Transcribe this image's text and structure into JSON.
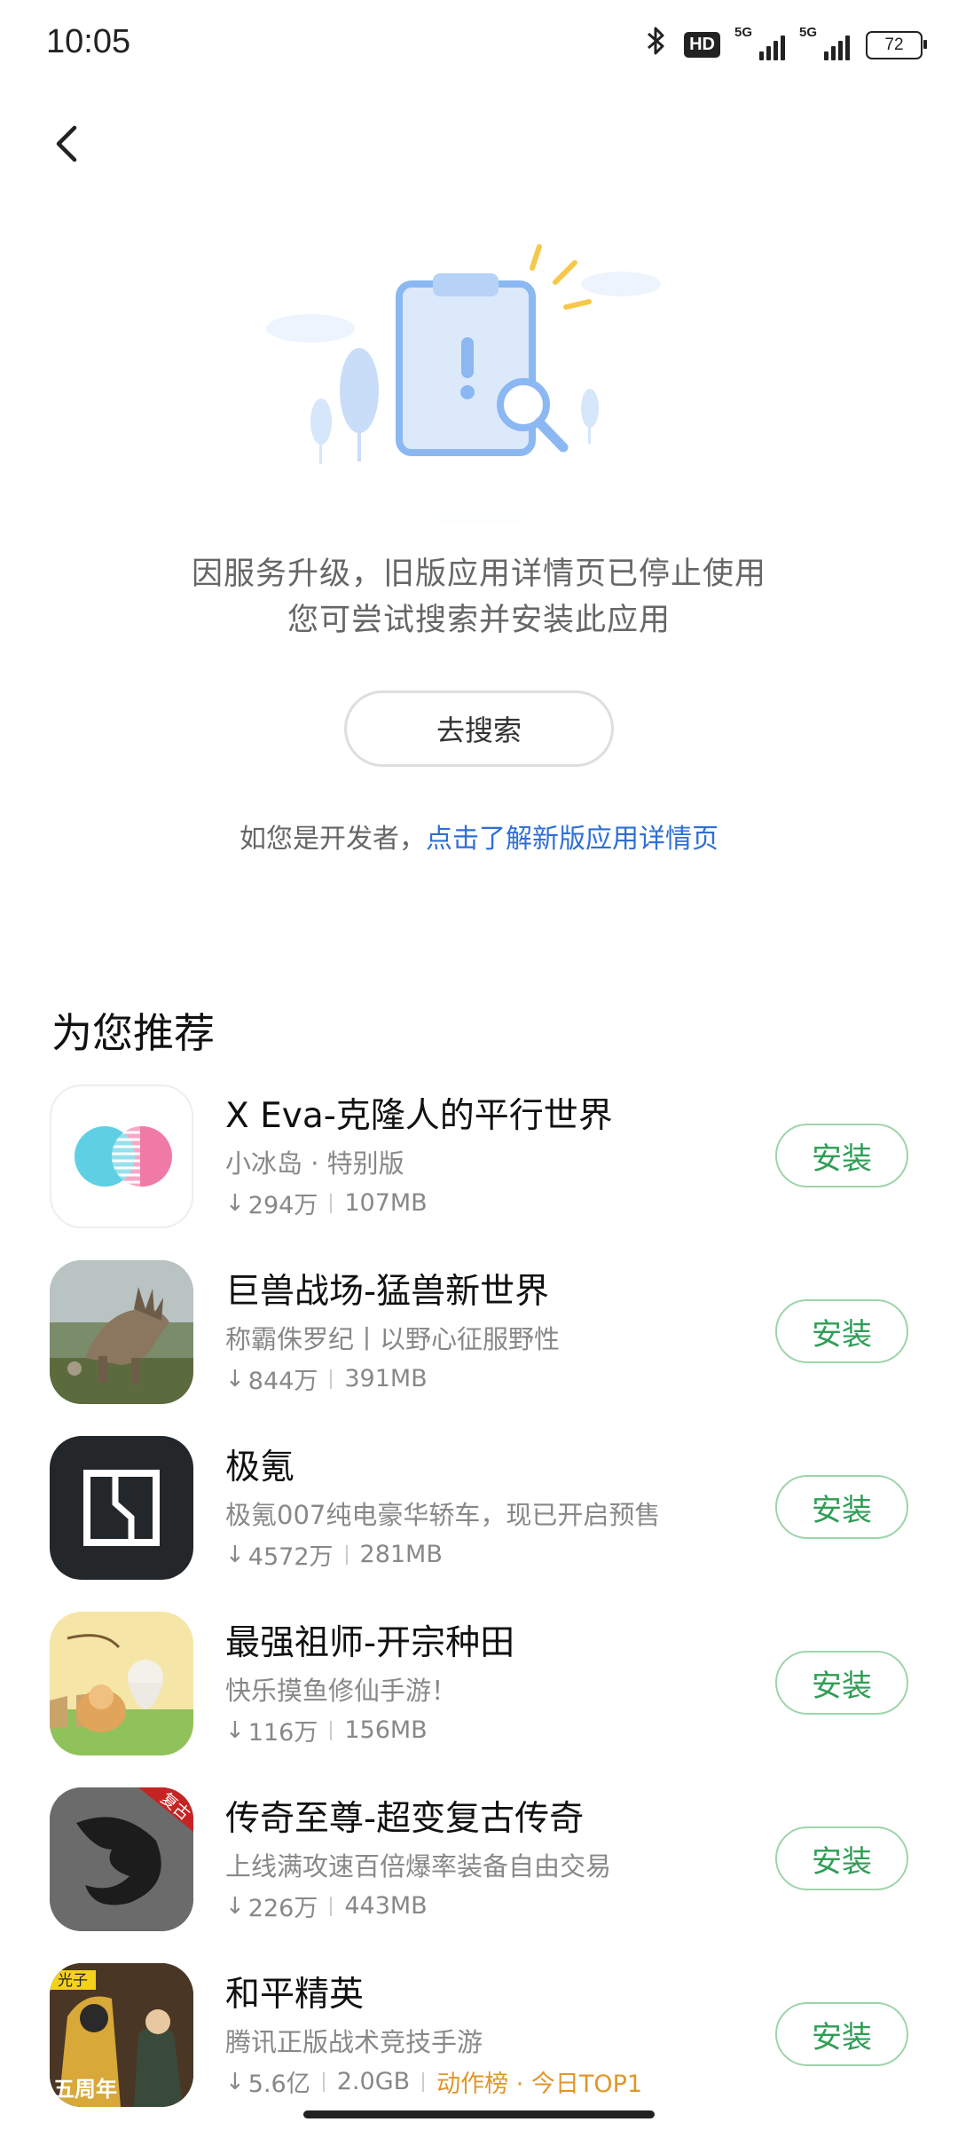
{
  "status_bar": {
    "time": "10:05",
    "hd": "HD",
    "signal_1": "5G",
    "signal_2": "5G",
    "battery": "72"
  },
  "notice": {
    "line1": "因服务升级，旧版应用详情页已停止使用",
    "line2": "您可尝试搜索并安装此应用",
    "search_button": "去搜索",
    "dev_prefix": "如您是开发者，",
    "dev_link": "点击了解新版应用详情页"
  },
  "recommend": {
    "title": "为您推荐",
    "apps": [
      {
        "name": "X Eva-克隆人的平行世界",
        "desc": "小冰岛 · 特别版",
        "downloads": "294万",
        "size": "107MB",
        "rank": "",
        "install": "安装",
        "icon": "xeva-icon"
      },
      {
        "name": "巨兽战场-猛兽新世界",
        "desc": "称霸侏罗纪丨以野心征服野性",
        "downloads": "844万",
        "size": "391MB",
        "rank": "",
        "install": "安装",
        "icon": "dinosaur-game-icon"
      },
      {
        "name": "极氪",
        "desc": "极氪007纯电豪华轿车，现已开启预售",
        "downloads": "4572万",
        "size": "281MB",
        "rank": "",
        "install": "安装",
        "icon": "zeekr-icon"
      },
      {
        "name": "最强祖师-开宗种田",
        "desc": "快乐摸鱼修仙手游！",
        "downloads": "116万",
        "size": "156MB",
        "rank": "",
        "install": "安装",
        "icon": "farming-game-icon"
      },
      {
        "name": "传奇至尊-超变复古传奇",
        "desc": "上线满攻速百倍爆率装备自由交易",
        "downloads": "226万",
        "size": "443MB",
        "rank": "",
        "install": "安装",
        "icon": "dragon-game-icon",
        "badge": "复古"
      },
      {
        "name": "和平精英",
        "desc": "腾讯正版战术竞技手游",
        "downloads": "5.6亿",
        "size": "2.0GB",
        "rank": "动作榜 · 今日TOP1",
        "install": "安装",
        "icon": "peace-elite-icon",
        "badge1": "光子",
        "badge2": "五周年"
      }
    ]
  },
  "colors": {
    "accent_link": "#2f6fd6",
    "install_text": "#2f9e55",
    "rank": "#e0962a"
  }
}
